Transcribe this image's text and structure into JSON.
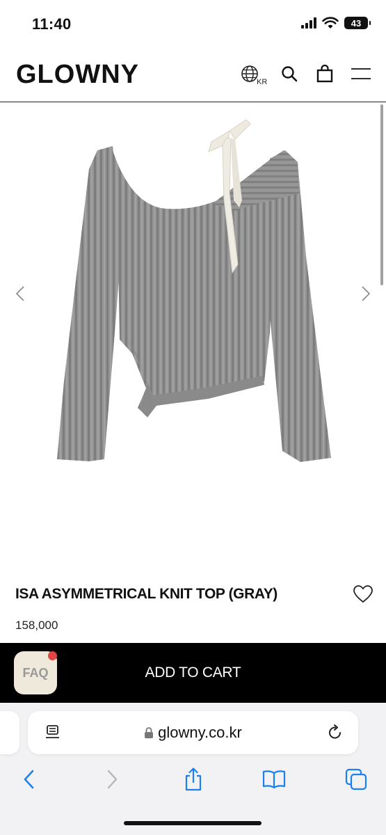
{
  "status_bar": {
    "time": "11:40",
    "battery": "43"
  },
  "header": {
    "logo": "GLOWNY",
    "region": "KR",
    "icons": [
      "globe-icon",
      "search-icon",
      "shopping-bag-icon",
      "menu-icon"
    ]
  },
  "product": {
    "title": "ISA ASYMMETRICAL KNIT TOP (GRAY)",
    "price": "158,000",
    "image_description_icon": "knit-top-image"
  },
  "cart": {
    "add_label": "ADD TO CART",
    "faq_label": "FAQ"
  },
  "browser": {
    "url": "glowny.co.kr",
    "toolbar": [
      "back-icon",
      "forward-icon",
      "share-icon",
      "bookmarks-icon",
      "tabs-icon"
    ]
  },
  "colors": {
    "accent_blue": "#1a7ff0",
    "cart_bar": "#000000",
    "faq_bg": "#efe9dc",
    "badge_red": "#e34545",
    "sweater_gray": "#8e8e8e"
  }
}
